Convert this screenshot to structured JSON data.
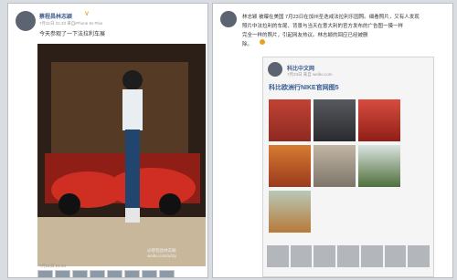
{
  "left_post": {
    "username": "蔡程昌林志颖",
    "badge": "V",
    "time": "7月21日 21:33 来自iPhone 6s Plus",
    "text": "今天参观了一下法拉利车展",
    "watermark": "@蔡程昌林志颖\nweibo.com/u/lzy",
    "footer_time": "7月21日 21:33"
  },
  "right_post": {
    "text_line1": "林志颖 被曝在美国 7月23日在加州圣迭戒法拉利乐园照。细看照片，又有人发现",
    "text_line2": "照片中法拉利的车尾、背景与当天在意大利的官方发布的广告图一摸一样",
    "text_line3": "完全一样的照片，引起网友热议。林志颖的回应已经被删",
    "text_line4": "除。",
    "card_account": "科比中文网",
    "card_time": "7月23日 来自 weibo.com",
    "card_title": "科比欧洲行NIKE官网图5"
  }
}
